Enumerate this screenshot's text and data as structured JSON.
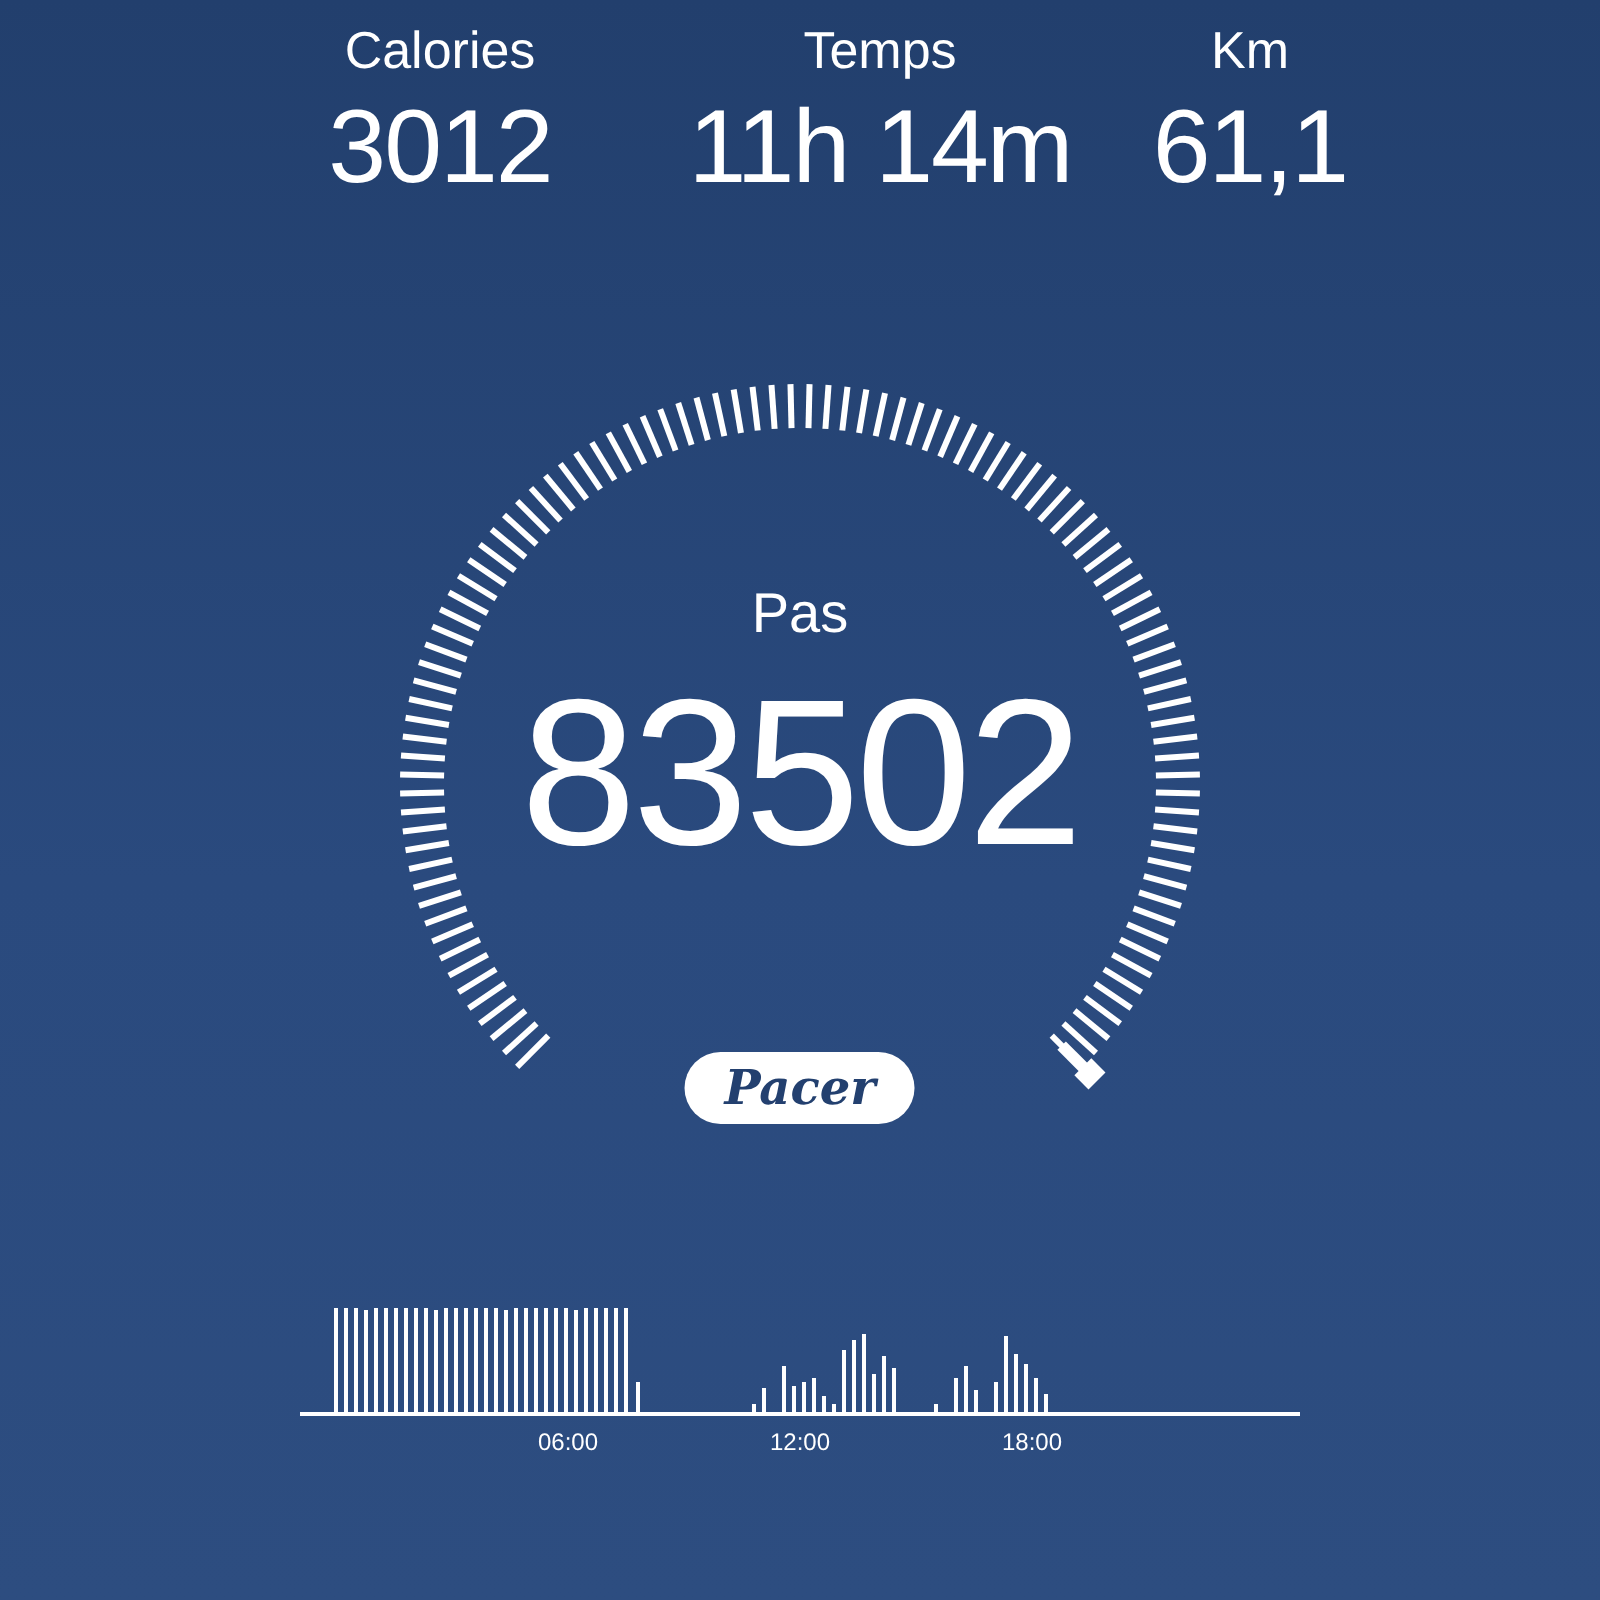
{
  "stats": [
    {
      "label": "Calories",
      "value": "3012"
    },
    {
      "label": "Temps",
      "value": "11h 14m"
    },
    {
      "label": "Km",
      "value": "61,1"
    }
  ],
  "steps": {
    "label": "Pas",
    "value": "83502"
  },
  "logo": "Pacer",
  "activity": {
    "time_labels": [
      "06:00",
      "12:00",
      "18:00"
    ]
  }
}
